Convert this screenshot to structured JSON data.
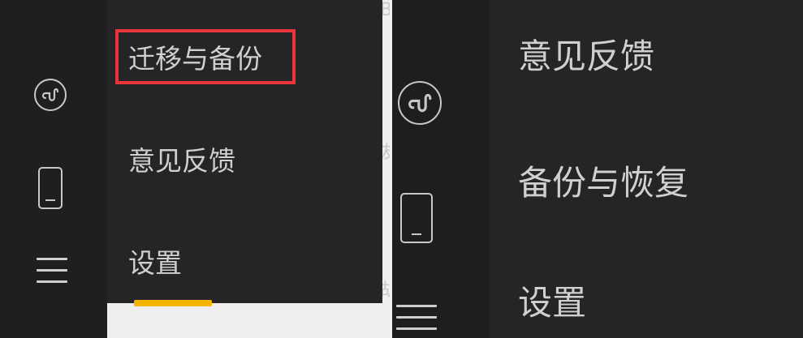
{
  "left_panel": {
    "menu": [
      {
        "label": "迁移与备份",
        "highlighted": true
      },
      {
        "label": "意见反馈"
      },
      {
        "label": "设置"
      }
    ],
    "sidebar_icons": [
      "mini-program-icon",
      "phone-icon",
      "hamburger-menu-icon"
    ],
    "background_text": [
      "B",
      "友",
      "胡"
    ]
  },
  "right_panel": {
    "menu": [
      {
        "label": "意见反馈"
      },
      {
        "label": "备份与恢复"
      },
      {
        "label": "设置"
      }
    ],
    "sidebar_icons": [
      "mini-program-icon",
      "phone-icon",
      "hamburger-menu-icon"
    ]
  },
  "colors": {
    "sidebar": "#1f1f21",
    "menu_bg": "#252527",
    "menu_text": "#d0d0d0",
    "highlight_border": "#e8343a",
    "accent_yellow": "#f5b400"
  }
}
